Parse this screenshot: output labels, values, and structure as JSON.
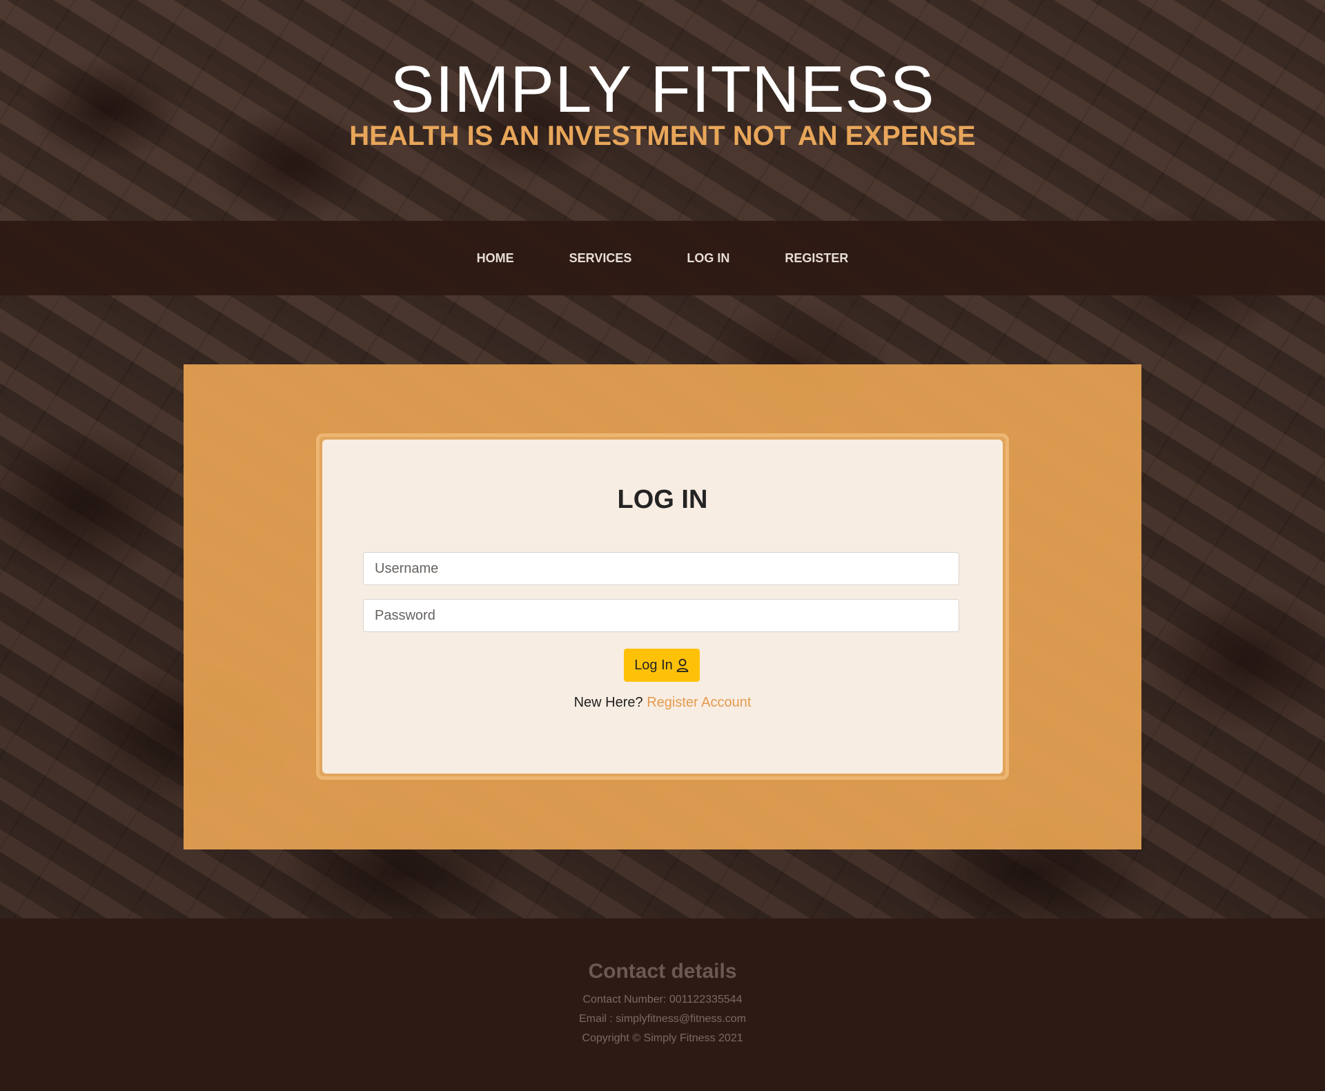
{
  "header": {
    "title": "SIMPLY FITNESS",
    "tagline": "HEALTH IS AN INVESTMENT NOT AN EXPENSE"
  },
  "nav": {
    "items": [
      {
        "label": "HOME"
      },
      {
        "label": "SERVICES"
      },
      {
        "label": "LOG IN"
      },
      {
        "label": "REGISTER"
      }
    ]
  },
  "login": {
    "title": "LOG IN",
    "username": {
      "placeholder": "Username",
      "value": ""
    },
    "password": {
      "placeholder": "Password",
      "value": ""
    },
    "button_label": "Log In",
    "button_icon": "user-icon",
    "prompt_text": "New Here?",
    "register_link": "Register Account"
  },
  "footer": {
    "heading": "Contact details",
    "contact_number": "Contact Number: 001122335544",
    "email": "Email : simplyfitness@fitness.com",
    "copyright": "Copyright © Simply Fitness 2021"
  },
  "colors": {
    "accent": "#e8a65a",
    "panel": "#e6a352",
    "button": "#ffc107",
    "dark": "#2e1a14"
  }
}
